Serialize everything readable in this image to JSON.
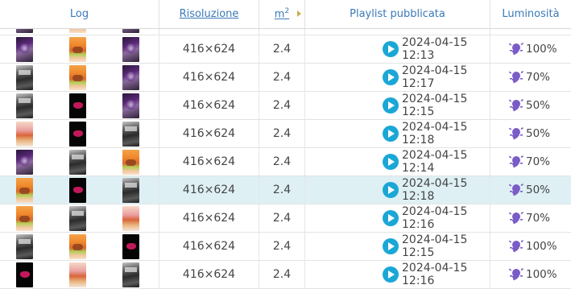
{
  "headers": {
    "log": "Log",
    "resolution": "Risoluzione",
    "m2_base": "m",
    "m2_sup": "2",
    "playlist": "Playlist pubblicata",
    "brightness": "Luminosità"
  },
  "rows": [
    {
      "thumbs": [
        "purple",
        "food",
        "purple"
      ],
      "resolution": "",
      "m2": "",
      "playlist": "",
      "brightness": "",
      "partial": true
    },
    {
      "thumbs": [
        "purple",
        "food",
        "purple"
      ],
      "resolution": "416×624",
      "m2": "2.4",
      "playlist": "2024-04-15 12:13",
      "brightness": "100%"
    },
    {
      "thumbs": [
        "poster",
        "food",
        "purple"
      ],
      "resolution": "416×624",
      "m2": "2.4",
      "playlist": "2024-04-15 12:17",
      "brightness": "70%"
    },
    {
      "thumbs": [
        "poster",
        "dark",
        "purple"
      ],
      "resolution": "416×624",
      "m2": "2.4",
      "playlist": "2024-04-15 12:15",
      "brightness": "50%"
    },
    {
      "thumbs": [
        "food2",
        "dark",
        "poster"
      ],
      "resolution": "416×624",
      "m2": "2.4",
      "playlist": "2024-04-15 12:18",
      "brightness": "50%"
    },
    {
      "thumbs": [
        "purple",
        "poster",
        "food"
      ],
      "resolution": "416×624",
      "m2": "2.4",
      "playlist": "2024-04-15 12:14",
      "brightness": "70%"
    },
    {
      "thumbs": [
        "food",
        "dark",
        "poster"
      ],
      "resolution": "416×624",
      "m2": "2.4",
      "playlist": "2024-04-15 12:18",
      "brightness": "50%",
      "highlighted": true
    },
    {
      "thumbs": [
        "food",
        "poster",
        "food2"
      ],
      "resolution": "416×624",
      "m2": "2.4",
      "playlist": "2024-04-15 12:16",
      "brightness": "70%"
    },
    {
      "thumbs": [
        "poster",
        "food",
        "dark"
      ],
      "resolution": "416×624",
      "m2": "2.4",
      "playlist": "2024-04-15 12:15",
      "brightness": "100%"
    },
    {
      "thumbs": [
        "dark",
        "food2",
        "poster"
      ],
      "resolution": "416×624",
      "m2": "2.4",
      "playlist": "2024-04-15 12:16",
      "brightness": "100%"
    }
  ],
  "colors": {
    "play_icon": "#1ba7d6",
    "bulb_icon": "#7a5cc8",
    "highlight_row": "#def0f4",
    "header_link": "#3a7ab8"
  },
  "icons": {
    "play": "play-circle-icon",
    "brightness": "light-bulb-icon",
    "sort_caret": "sort-caret-icon"
  }
}
